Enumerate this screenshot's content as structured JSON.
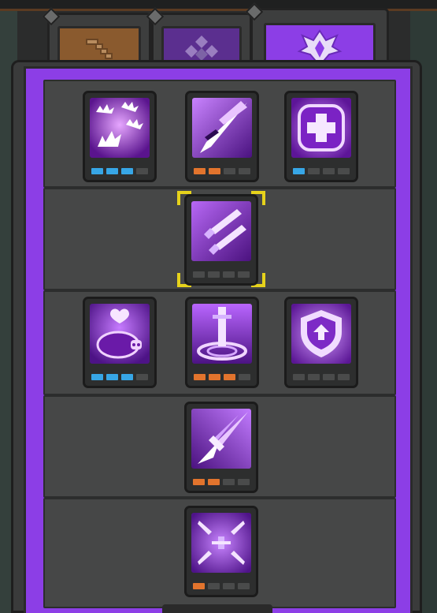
{
  "tabs": [
    {
      "name": "tab-weapon",
      "icon": "stairs-icon",
      "active": false
    },
    {
      "name": "tab-gems",
      "icon": "diamond-cluster-icon",
      "active": false
    },
    {
      "name": "tab-talents",
      "icon": "crest-icon",
      "active": true
    }
  ],
  "colors": {
    "panel_accent": "#8c3ee6",
    "blue_pip": "#37a6e6",
    "orange_pip": "#e2742d",
    "selection": "#e6d21b"
  },
  "rows": [
    {
      "skills": [
        {
          "name": "burst-sparks",
          "icon": "burst-icon",
          "pip_color": "blue",
          "filled": 3,
          "total": 4
        },
        {
          "name": "piercing-strike",
          "icon": "spear-thrust-icon",
          "pip_color": "orange",
          "filled": 2,
          "total": 4
        },
        {
          "name": "heal-cross",
          "icon": "health-cross-icon",
          "pip_color": "blue",
          "filled": 1,
          "total": 4
        }
      ]
    },
    {
      "skills": [
        {
          "name": "twin-swords",
          "icon": "twin-swords-icon",
          "pip_color": "orange",
          "filled": 0,
          "total": 4,
          "selected": true
        }
      ]
    },
    {
      "skills": [
        {
          "name": "pet-heal",
          "icon": "pig-heart-icon",
          "pip_color": "blue",
          "filled": 3,
          "total": 4
        },
        {
          "name": "sword-circle",
          "icon": "sword-circle-icon",
          "pip_color": "orange",
          "filled": 3,
          "total": 4
        },
        {
          "name": "shield-upgrade",
          "icon": "shield-arrow-icon",
          "pip_color": "orange",
          "filled": 0,
          "total": 4
        }
      ]
    },
    {
      "skills": [
        {
          "name": "dash-strike",
          "icon": "dash-arrow-icon",
          "pip_color": "orange",
          "filled": 2,
          "total": 4
        }
      ]
    },
    {
      "skills": [
        {
          "name": "sword-rain",
          "icon": "sword-swarm-icon",
          "pip_color": "orange",
          "filled": 1,
          "total": 4
        }
      ]
    }
  ]
}
